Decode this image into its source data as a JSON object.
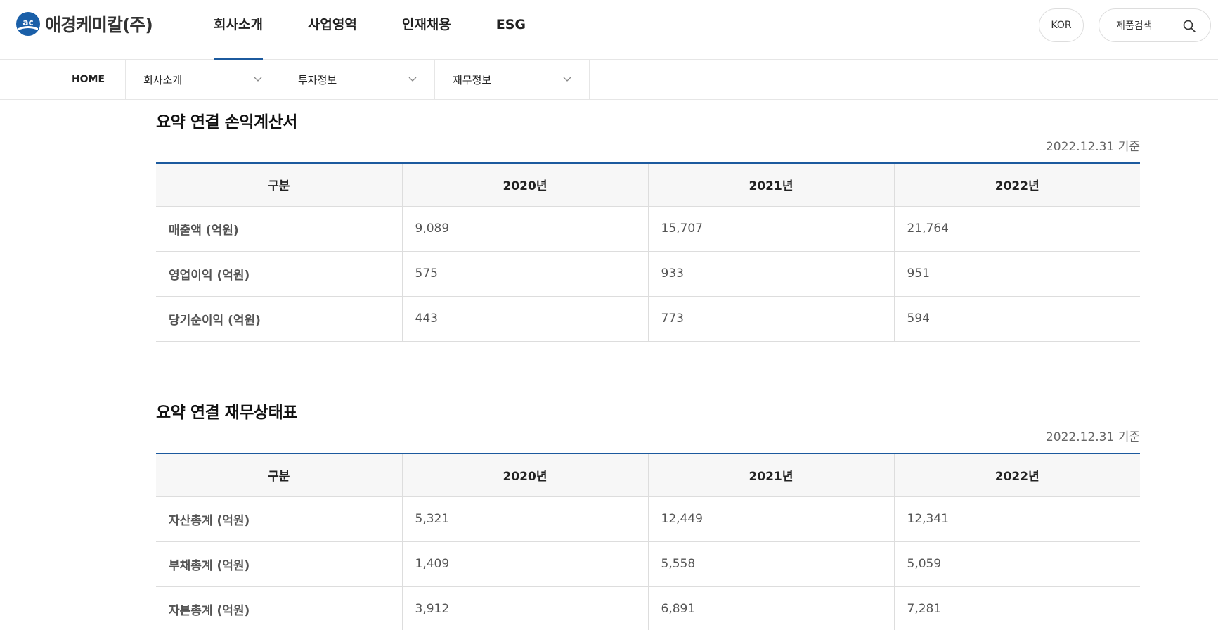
{
  "header": {
    "logo_text": "애경케미칼(주)",
    "nav": [
      "회사소개",
      "사업영역",
      "인재채용",
      "ESG"
    ],
    "active_nav": "회사소개",
    "lang_label": "KOR",
    "search_label": "제품검색"
  },
  "breadcrumb": {
    "home": "HOME",
    "level1": "회사소개",
    "level2": "투자정보",
    "level3": "재무정보"
  },
  "income": {
    "title": "요약 연결 손익계산서",
    "basis": "2022.12.31 기준",
    "headers": [
      "구분",
      "2020년",
      "2021년",
      "2022년"
    ],
    "rows": [
      {
        "label": "매출액 (억원)",
        "v2020": "9,089",
        "v2021": "15,707",
        "v2022": "21,764"
      },
      {
        "label": "영업이익 (억원)",
        "v2020": "575",
        "v2021": "933",
        "v2022": "951"
      },
      {
        "label": "당기순이익 (억원)",
        "v2020": "443",
        "v2021": "773",
        "v2022": "594"
      }
    ]
  },
  "balance": {
    "title": "요약 연결 재무상태표",
    "basis": "2022.12.31 기준",
    "headers": [
      "구분",
      "2020년",
      "2021년",
      "2022년"
    ],
    "rows": [
      {
        "label": "자산총계 (억원)",
        "v2020": "5,321",
        "v2021": "12,449",
        "v2022": "12,341"
      },
      {
        "label": "부채총계 (억원)",
        "v2020": "1,409",
        "v2021": "5,558",
        "v2022": "5,059"
      },
      {
        "label": "자본총계 (억원)",
        "v2020": "3,912",
        "v2021": "6,891",
        "v2022": "7,281"
      }
    ]
  },
  "colors": {
    "accent": "#1c5a9e",
    "logo_blue": "#1a5fa8"
  },
  "icons": {
    "logo": "ac-logo-icon",
    "search": "search-icon",
    "dropdown": "chevron-down-icon"
  }
}
